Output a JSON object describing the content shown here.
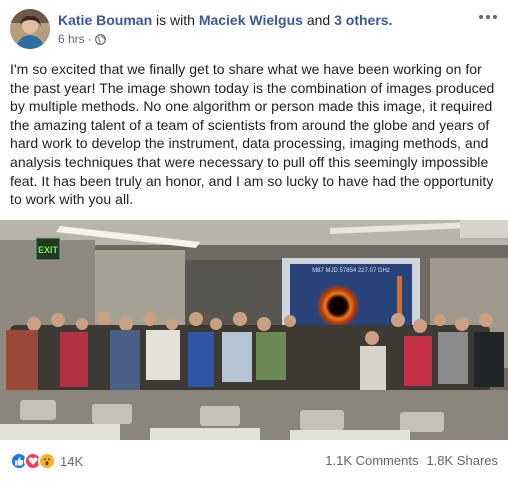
{
  "post": {
    "author": "Katie Bouman",
    "with_text": "is with",
    "tagged_person": "Maciek Wielgus",
    "and_text": "and",
    "others": "3 others.",
    "time": "6 hrs",
    "separator": "·",
    "privacy_icon": "globe-icon",
    "more_icon": "more-options-icon",
    "text": "I'm so excited that we finally get to share what we have been working on for the past year! The image shown today is the combination of images produced by multiple methods. No one algorithm or person made this image, it required the amazing talent of a team of scientists from around the globe and years of hard work to develop the instrument, data processing, imaging methods, and analysis techniques that were necessary to pull off this seemingly impossible feat. It has been truly an honor, and I am so lucky to have had the opportunity to work with you all."
  },
  "photo": {
    "exit_sign": "EXIT",
    "screen_caption": "M87   MJD 57854  227.07 GHz"
  },
  "footer": {
    "reaction_icons": [
      "like-icon",
      "love-icon",
      "wow-icon"
    ],
    "reaction_count": "14K",
    "comments": "1.1K Comments",
    "shares": "1.8K Shares"
  },
  "colors": {
    "link": "#385898",
    "like": "#1877f2",
    "love": "#f33e58",
    "wow": "#f7b125",
    "muted": "#606770"
  }
}
